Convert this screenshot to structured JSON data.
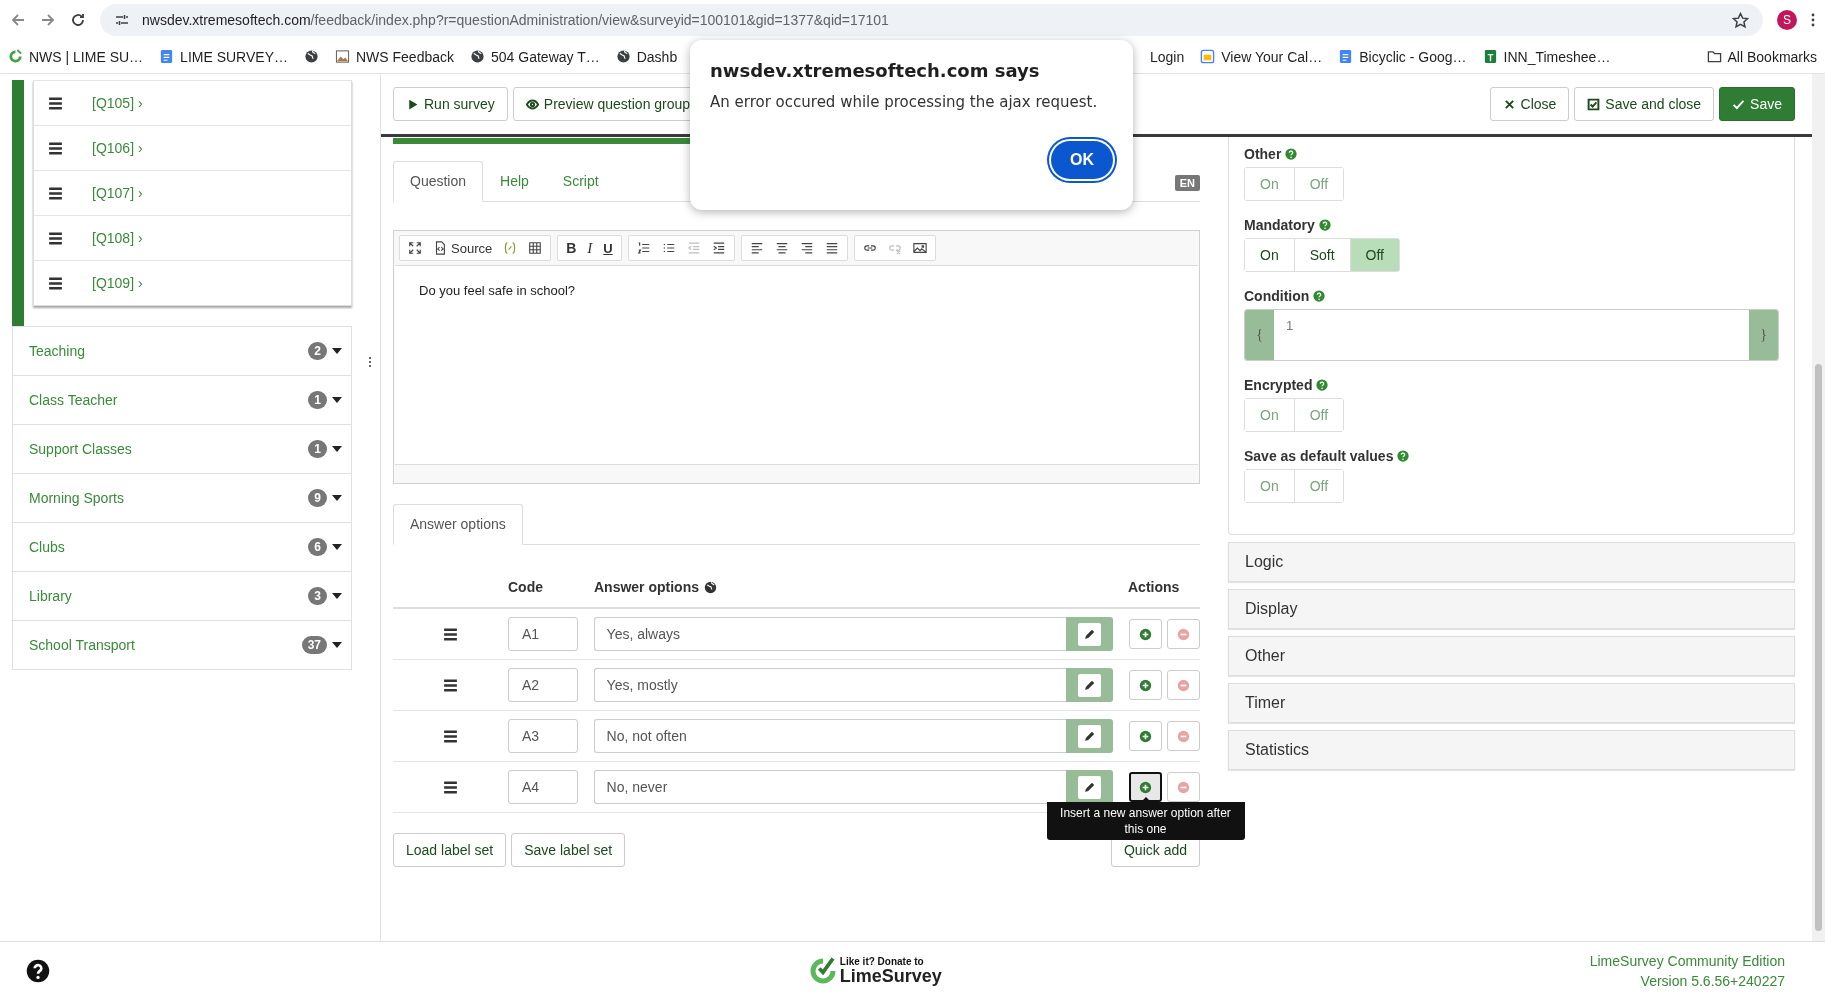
{
  "browser": {
    "url": {
      "host": "nwsdev.xtremesoftech.com",
      "path": "/feedback/index.php?r=questionAdministration/view&surveyid=100101&gid=1377&qid=17101"
    },
    "profile_initial": "S",
    "bookmarks": [
      {
        "kind": "lime",
        "label": "NWS | LIME SU…"
      },
      {
        "kind": "doc",
        "label": "LIME SURVEY…"
      },
      {
        "kind": "globe"
      },
      {
        "kind": "image",
        "label": "NWS Feedback"
      },
      {
        "kind": "globe",
        "label": "504 Gateway T…"
      },
      {
        "kind": "globe",
        "label": "Dashb"
      }
    ],
    "bookmarks_right": [
      {
        "label": "Login"
      },
      {
        "kind": "calendar",
        "label": "View Your Cal…"
      },
      {
        "kind": "doc",
        "label": "Bicyclic - Goog…"
      },
      {
        "kind": "sheet",
        "label": "INN_Timeshee…"
      }
    ],
    "all_bookmarks": "All Bookmarks"
  },
  "sidebar": {
    "questions": [
      {
        "label": "[Q105] ›"
      },
      {
        "label": "[Q106] ›"
      },
      {
        "label": "[Q107] ›"
      },
      {
        "label": "[Q108] ›"
      },
      {
        "label": "[Q109] ›"
      }
    ],
    "groups": [
      {
        "label": "Teaching",
        "count": "2"
      },
      {
        "label": "Class Teacher",
        "count": "1"
      },
      {
        "label": "Support Classes",
        "count": "1"
      },
      {
        "label": "Morning Sports",
        "count": "9"
      },
      {
        "label": "Clubs",
        "count": "6"
      },
      {
        "label": "Library",
        "count": "3"
      },
      {
        "label": "School Transport",
        "count": "37"
      }
    ]
  },
  "header": {
    "left_buttons": [
      {
        "label": "Run survey"
      },
      {
        "label": "Preview question group"
      }
    ],
    "right_buttons": [
      {
        "label": "Close",
        "kind": "default"
      },
      {
        "label": "Save and close",
        "kind": "default"
      },
      {
        "label": "Save",
        "kind": "primary"
      }
    ]
  },
  "editor": {
    "tabs": [
      {
        "label": "Question",
        "selected": true
      },
      {
        "label": "Help",
        "selected": false
      },
      {
        "label": "Script",
        "selected": false
      }
    ],
    "language": "EN",
    "toolbar": [
      [
        {
          "kind": "maximize",
          "disabled": false
        },
        {
          "kind": "source",
          "label": "Source",
          "disabled": false
        },
        {
          "kind": "placeholder",
          "disabled": false
        },
        {
          "kind": "table",
          "disabled": false
        }
      ],
      [
        {
          "kind": "bold",
          "label": "B",
          "disabled": false
        },
        {
          "kind": "italic",
          "label": "I",
          "disabled": false
        },
        {
          "kind": "underline",
          "label": "U",
          "disabled": false
        }
      ],
      [
        {
          "kind": "ordered-list",
          "disabled": false
        },
        {
          "kind": "bullet-list",
          "disabled": false
        },
        {
          "kind": "outdent",
          "disabled": true
        },
        {
          "kind": "indent",
          "disabled": false
        }
      ],
      [
        {
          "kind": "align-left",
          "disabled": false
        },
        {
          "kind": "align-center",
          "disabled": false
        },
        {
          "kind": "align-right",
          "disabled": false
        },
        {
          "kind": "justify",
          "disabled": false
        }
      ],
      [
        {
          "kind": "link",
          "disabled": false
        },
        {
          "kind": "unlink",
          "disabled": true
        },
        {
          "kind": "image",
          "disabled": false
        }
      ]
    ],
    "text": "Do you feel safe in school?"
  },
  "answer_options": {
    "tab": "Answer options",
    "columns": [
      "Code",
      "Answer options",
      "Actions"
    ],
    "rows": [
      {
        "code": "A1",
        "text": "Yes, always",
        "add_focused": false
      },
      {
        "code": "A2",
        "text": "Yes, mostly",
        "add_focused": false
      },
      {
        "code": "A3",
        "text": "No, not often",
        "add_focused": false
      },
      {
        "code": "A4",
        "text": "No, never",
        "add_focused": true
      }
    ],
    "tooltip": "Insert a new answer option after this one",
    "buttons": [
      "Load label set",
      "Save label set",
      "Quick add"
    ]
  },
  "settings": [
    {
      "kind": "toggle",
      "label": "Other",
      "disabled": true,
      "options": [
        {
          "label": "On",
          "selected": false
        },
        {
          "label": "Off",
          "selected": false
        }
      ]
    },
    {
      "kind": "toggle",
      "label": "Mandatory",
      "disabled": false,
      "options": [
        {
          "label": "On",
          "selected": false
        },
        {
          "label": "Soft",
          "selected": false
        },
        {
          "label": "Off",
          "selected": true
        }
      ]
    },
    {
      "kind": "expression",
      "label": "Condition",
      "value": "1",
      "open": "{",
      "close": "}"
    },
    {
      "kind": "toggle",
      "label": "Encrypted",
      "disabled": true,
      "options": [
        {
          "label": "On",
          "selected": false
        },
        {
          "label": "Off",
          "selected": false
        }
      ]
    },
    {
      "kind": "toggle",
      "label": "Save as default values",
      "disabled": true,
      "options": [
        {
          "label": "On",
          "selected": false
        },
        {
          "label": "Off",
          "selected": false
        }
      ]
    }
  ],
  "panels": [
    "Logic",
    "Display",
    "Other",
    "Timer",
    "Statistics"
  ],
  "footer": {
    "tagline": "Like it? Donate to",
    "brand": "LimeSurvey",
    "edition": "LimeSurvey Community Edition",
    "version": "Version 5.6.56+240227"
  },
  "dialog": {
    "title": "nwsdev.xtremesoftech.com says",
    "message": "An error occured while processing the ajax request.",
    "button": "OK"
  }
}
